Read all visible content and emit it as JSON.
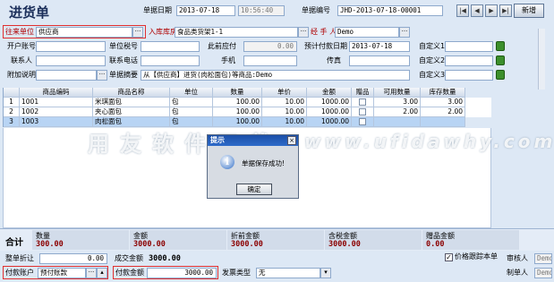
{
  "title": "进货单",
  "header": {
    "date_label": "单据日期",
    "date_value": "2013-07-18",
    "time_value": "10:56:40",
    "bill_no_label": "单据编号",
    "bill_no_value": "JHD-2013-07-18-00001",
    "nav": [
      "|◀",
      "◀",
      "▶",
      "▶|"
    ],
    "new_button": "新增"
  },
  "form": {
    "supplier_label": "往来单位",
    "supplier_value": "供应商",
    "warehouse_label": "入库库房",
    "warehouse_value": "食品类货架1-1",
    "handler_label": "经 手 人",
    "handler_value": "Demo",
    "account_label": "开户账号",
    "tax_label": "单位税号",
    "payable_label": "此前应付",
    "payable_value": "0.00",
    "paydate_label": "预计付款日期",
    "paydate_value": "2013-07-18",
    "custom1_label": "自定义1",
    "contact_label": "联系人",
    "phone_label": "联系电话",
    "mobile_label": "手机",
    "fax_label": "传真",
    "custom2_label": "自定义2",
    "note_label": "附加说明",
    "summary_label": "单据摘要",
    "summary_value": "从【供应商】进货(肉松面包)等商品:Demo",
    "custom3_label": "自定义3"
  },
  "grid": {
    "columns": [
      "",
      "商品编码",
      "商品名称",
      "单位",
      "数量",
      "单价",
      "金额",
      "赠品",
      "可用数量",
      "库存数量"
    ],
    "rows": [
      [
        "1",
        "1001",
        "米琪面包",
        "包",
        "100.00",
        "10.00",
        "1000.00",
        "",
        "3.00",
        "3.00"
      ],
      [
        "2",
        "1002",
        "夹心面包",
        "包",
        "100.00",
        "10.00",
        "1000.00",
        "",
        "2.00",
        "2.00"
      ],
      [
        "3",
        "1003",
        "肉松面包",
        "包",
        "100.00",
        "10.00",
        "1000.00",
        "",
        "",
        ""
      ]
    ]
  },
  "totals": {
    "label": "合计",
    "qty_label": "数量",
    "qty_value": "300.00",
    "amount_label": "金额",
    "amount_value": "3000.00",
    "pre_discount_label": "折前金额",
    "pre_discount_value": "3000.00",
    "tax_amount_label": "含税金额",
    "tax_amount_value": "3000.00",
    "gift_label": "赠品金额",
    "gift_value": "0.00"
  },
  "footer": {
    "discount_label": "整单折让",
    "discount_value": "0.00",
    "deal_label": "成交金额",
    "deal_value": "3000.00",
    "pay_account_label": "付款账户",
    "pay_account_value": "预付账款",
    "pay_amount_label": "付款金额",
    "pay_amount_value": "3000.00",
    "invoice_label": "发票类型",
    "invoice_value": "无",
    "track_cost_label": "价格跟踪本单",
    "reviewer_label": "审核人",
    "reviewer_value": "Demo",
    "maker_label": "制单人",
    "maker_value": "Demo"
  },
  "dialog": {
    "title": "提示",
    "message": "单据保存成功!",
    "ok": "确定"
  },
  "watermark": {
    "cn": "用友软件下载：",
    "url": "www.ufidawhy.com"
  }
}
